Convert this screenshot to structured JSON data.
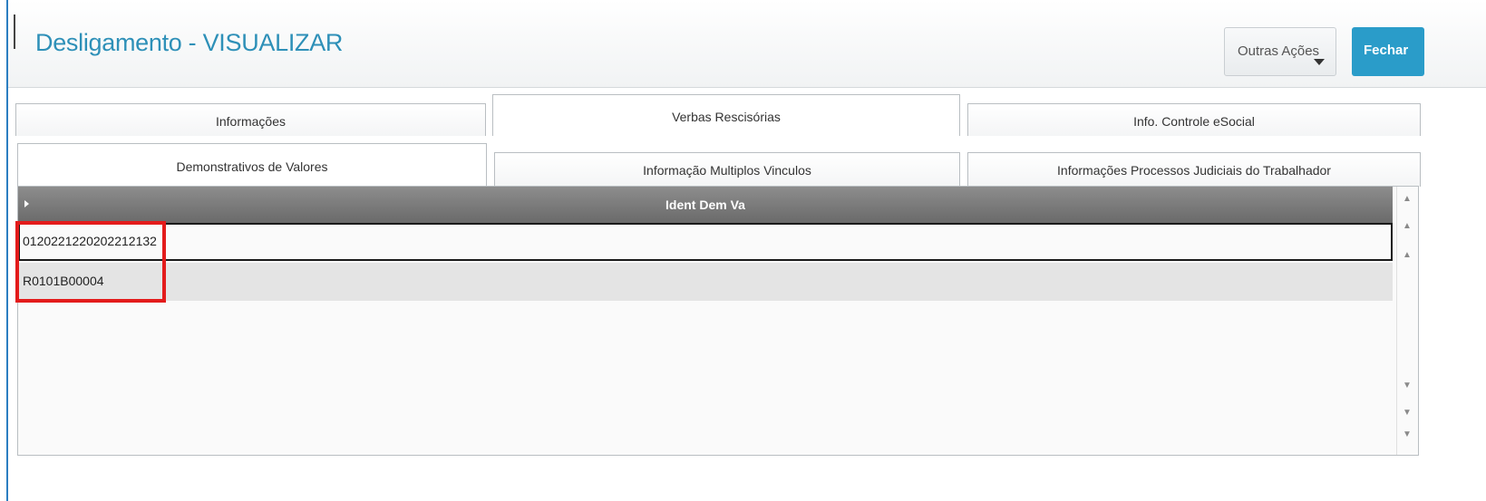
{
  "header": {
    "title": "Desligamento - VISUALIZAR",
    "other_actions_label": "Outras Ações",
    "close_label": "Fechar"
  },
  "tabs_row1": [
    {
      "label": "Informações",
      "active": false
    },
    {
      "label": "Verbas Rescisórias",
      "active": true
    },
    {
      "label": "Info. Controle eSocial",
      "active": false
    }
  ],
  "tabs_row2": [
    {
      "label": "Demonstrativos de Valores",
      "active": true
    },
    {
      "label": "Informação Multiplos Vinculos",
      "active": false
    },
    {
      "label": "Informações Processos Judiciais do Trabalhador",
      "active": false
    }
  ],
  "grid": {
    "column": "Ident Dem Va",
    "rows": [
      {
        "value": "0120221220202212132",
        "selected": true
      },
      {
        "value": "R0101B00004",
        "selected": false
      }
    ]
  },
  "colors": {
    "accent": "#2e90b8",
    "close_button": "#2a9cc9",
    "highlight": "#e31b1b"
  },
  "icons": [
    "caret-down-icon",
    "row-pointer-icon",
    "scroll-top-icon",
    "scroll-page-up-icon",
    "scroll-up-icon",
    "scroll-down-icon",
    "scroll-page-down-icon",
    "scroll-bottom-icon"
  ]
}
